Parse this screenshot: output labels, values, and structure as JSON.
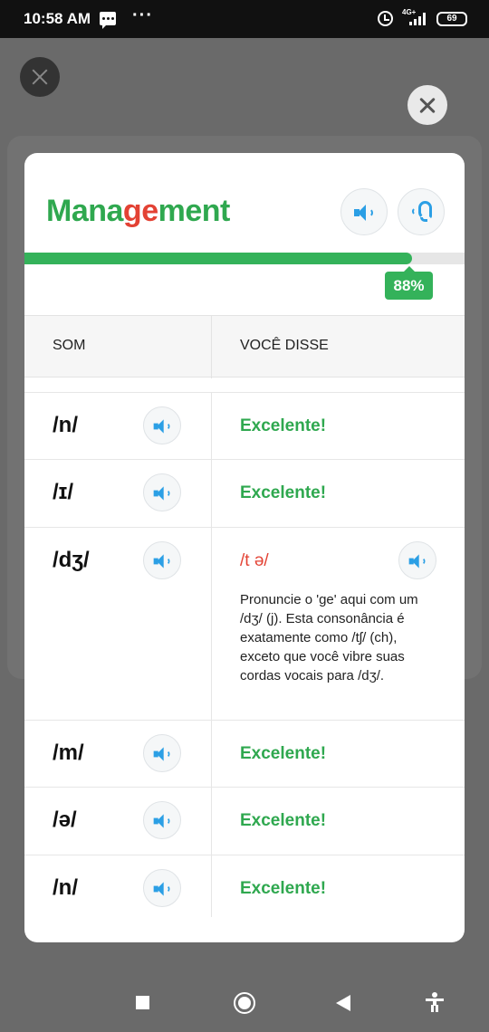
{
  "status_bar": {
    "time": "10:58 AM",
    "network": "4G+",
    "battery": "69"
  },
  "word": {
    "part1": "Mana",
    "part2": "ge",
    "part3": "ment"
  },
  "score": {
    "percent_label": "88%",
    "value": 0.88
  },
  "table": {
    "col_sound": "SOM",
    "col_said": "VOCÊ DISSE"
  },
  "rows": [
    {
      "symbol": "/n/",
      "result": "Excelente!"
    },
    {
      "symbol": "/ɪ/",
      "result": "Excelente!"
    },
    {
      "symbol": "/dʒ/",
      "result": "/t ə/",
      "tip": "Pronuncie o 'ge' aqui com um /dʒ/ (j). Esta consonância é exatamente como /tʃ/ (ch), exceto que você vibre suas cordas vocais para /dʒ/."
    },
    {
      "symbol": "/m/",
      "result": "Excelente!"
    },
    {
      "symbol": "/ə/",
      "result": "Excelente!"
    },
    {
      "symbol": "/n/",
      "result": "Excelente!"
    }
  ],
  "colors": {
    "success": "#2fa84f",
    "error": "#e34234",
    "icon": "#2b9fe5"
  }
}
